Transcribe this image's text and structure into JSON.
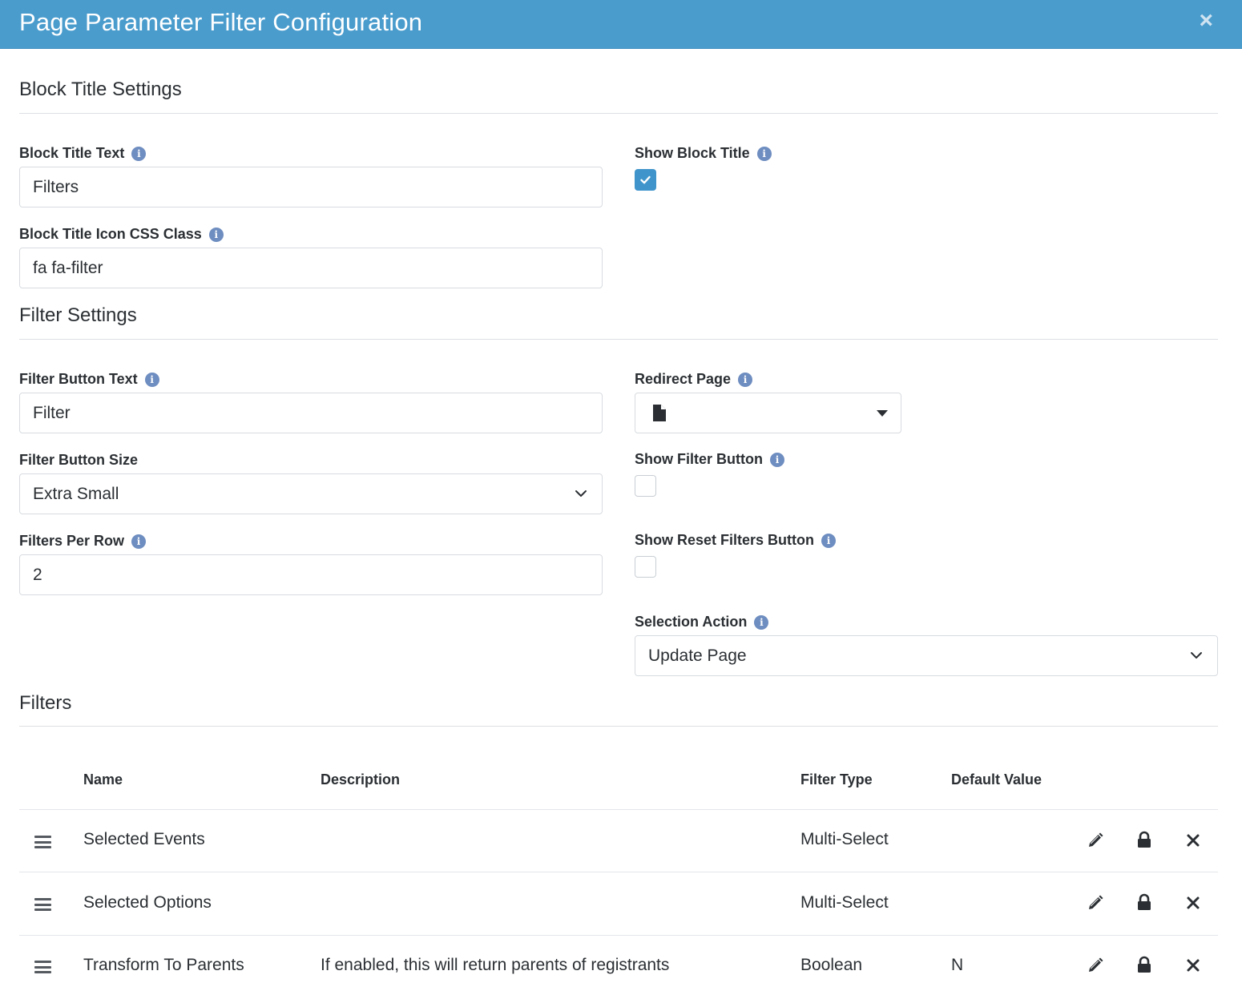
{
  "modal": {
    "title": "Page Parameter Filter Configuration",
    "close": "×"
  },
  "block_title_settings": {
    "heading": "Block Title Settings",
    "title_text": {
      "label": "Block Title Text",
      "value": "Filters"
    },
    "show_block_title": {
      "label": "Show Block Title",
      "checked": true
    },
    "icon_css_class": {
      "label": "Block Title Icon CSS Class",
      "value": "fa fa-filter"
    }
  },
  "filter_settings": {
    "heading": "Filter Settings",
    "button_text": {
      "label": "Filter Button Text",
      "value": "Filter"
    },
    "redirect_page": {
      "label": "Redirect Page",
      "value": ""
    },
    "button_size": {
      "label": "Filter Button Size",
      "value": "Extra Small"
    },
    "show_filter_button": {
      "label": "Show Filter Button",
      "checked": false
    },
    "filters_per_row": {
      "label": "Filters Per Row",
      "value": "2"
    },
    "show_reset_button": {
      "label": "Show Reset Filters Button",
      "checked": false
    },
    "selection_action": {
      "label": "Selection Action",
      "value": "Update Page"
    }
  },
  "filters": {
    "heading": "Filters",
    "columns": {
      "name": "Name",
      "description": "Description",
      "filter_type": "Filter Type",
      "default_value": "Default Value"
    },
    "rows": [
      {
        "name": "Selected Events",
        "description": "",
        "filter_type": "Multi-Select",
        "default_value": ""
      },
      {
        "name": "Selected Options",
        "description": "",
        "filter_type": "Multi-Select",
        "default_value": ""
      },
      {
        "name": "Transform To Parents",
        "description": "If enabled, this will return parents of registrants",
        "filter_type": "Boolean",
        "default_value": "N"
      }
    ]
  },
  "colors": {
    "header": "#4a9ccd",
    "checkbox_checked": "#3f95cb",
    "info_icon": "#6e8dc0"
  },
  "icons": [
    "close-icon",
    "info-icon",
    "check-icon",
    "file-icon",
    "caret-down-icon",
    "chevron-down-icon",
    "drag-handle-icon",
    "pencil-icon",
    "lock-icon",
    "delete-icon"
  ]
}
